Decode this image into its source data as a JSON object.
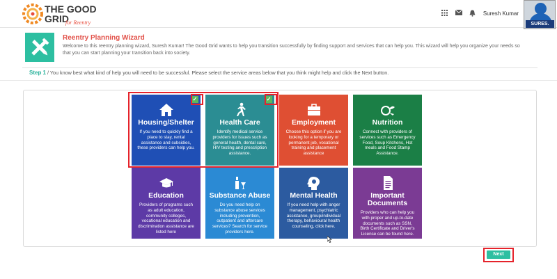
{
  "header": {
    "logo_line1": "THE GOOD",
    "logo_line2": "GRID",
    "logo_tagline": "for Reentry",
    "icons": [
      "grid-icon",
      "envelope-icon",
      "bell-icon"
    ],
    "user_name": "Suresh Kumar",
    "avatar_badge": "SURES."
  },
  "wizard": {
    "title": "Reentry Planning Wizard",
    "description": "Welcome to this reentry planning wizard, Suresh Kumar! The Good Grid wants to help you transition successfully by finding support and services that can help you. This wizard will help you organize your needs so that you can start planning your transition back into society.",
    "step_label": "Step 1",
    "step_text": " / You know best what kind of help you will need to be successful. Please select the service areas below that you think might help and click the Next button."
  },
  "tiles": [
    {
      "name": "housing",
      "title": "Housing/Shelter",
      "color": "#1f4fb5",
      "selected": true,
      "desc": "If you need to quickly find a place to stay, rental assistance and subsidies, these providers can help you."
    },
    {
      "name": "health-care",
      "title": "Health Care",
      "color": "#2b8d93",
      "selected": true,
      "desc": "Identify medical service providers for issues such as general health, dental care, HIV testing and prescription assistance."
    },
    {
      "name": "employment",
      "title": "Employment",
      "color": "#df4f33",
      "selected": false,
      "desc": "Choose this option if you are looking for a temporary or permanent job, vocational training and placement assistance"
    },
    {
      "name": "nutrition",
      "title": "Nutrition",
      "color": "#1b7f46",
      "selected": false,
      "desc": "Connect with providers of services such as Emergency Food, Soup Kitchens, Hot meals and Food Stamp Assistance."
    },
    {
      "name": "education",
      "title": "Education",
      "color": "#5d3aa6",
      "selected": false,
      "desc": "Providers of programs such as adult education, community colleges, vocational education and discrimination assistance are listed here"
    },
    {
      "name": "substance-abuse",
      "title": "Substance Abuse",
      "color": "#2b8ad4",
      "selected": false,
      "desc": "Do you need help on substance abuse services including prevention, outpatient and aftercare services? Search for service providers here."
    },
    {
      "name": "mental-health",
      "title": "Mental Health",
      "color": "#2c5ba0",
      "selected": false,
      "desc": "If you need help with anger management, psychiatric assistance, group/individual therapy, behavioural health counseling, click here."
    },
    {
      "name": "important-documents",
      "title": "Important Documents",
      "color": "#7b3b94",
      "selected": false,
      "desc": "Providers who can help you with proper and up-to-date documents such as SSN, Birth Certificate and Driver's License can be found here."
    }
  ],
  "next_button": "Next"
}
